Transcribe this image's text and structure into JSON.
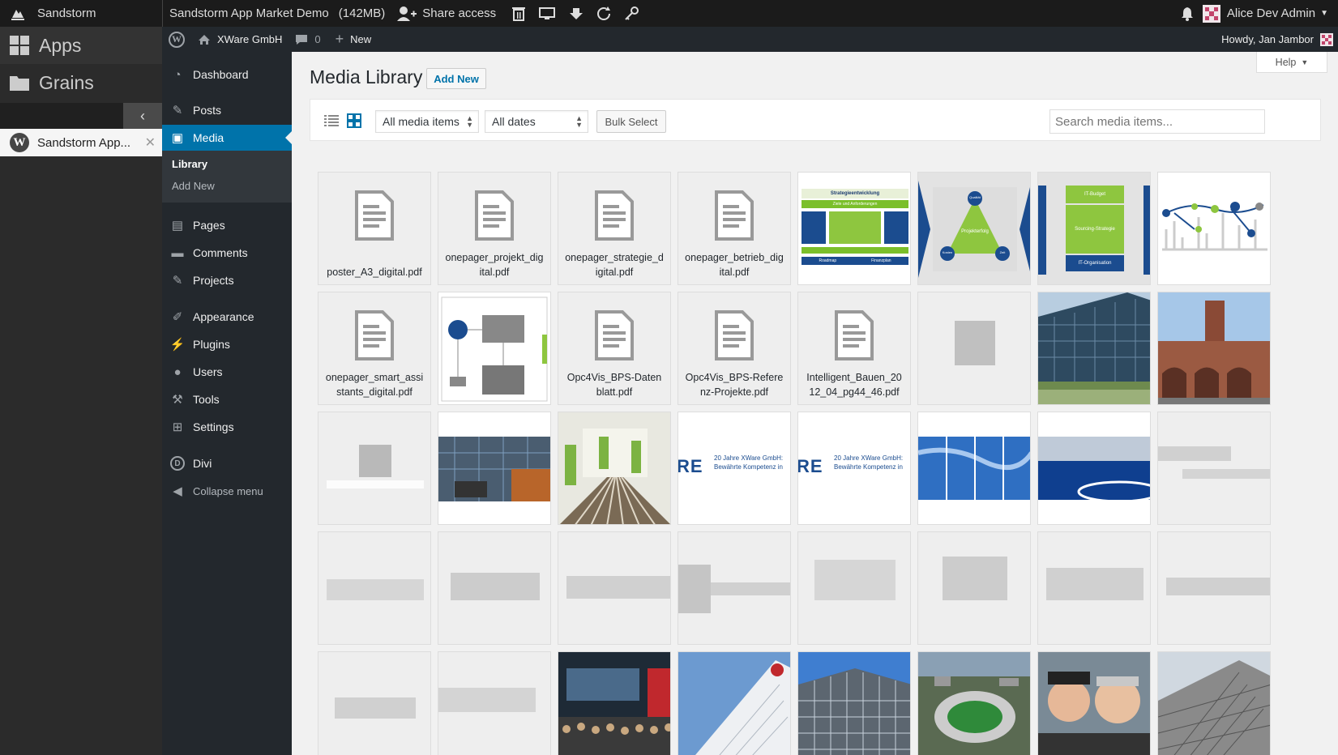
{
  "sandstorm": {
    "brand": "Sandstorm",
    "nav": [
      {
        "label": "Apps",
        "icon": "apps-grid-icon"
      },
      {
        "label": "Grains",
        "icon": "folder-icon"
      }
    ],
    "open_grain": {
      "label": "Sandstorm App...",
      "icon": "wordpress-icon"
    },
    "grain_title": "Sandstorm App Market Demo",
    "grain_size": "(142MB)",
    "share_label": "Share access",
    "user_name": "Alice Dev Admin"
  },
  "wpbar": {
    "site_name": "XWare GmbH",
    "comments_count": "0",
    "new_label": "New",
    "howdy": "Howdy, Jan Jambor"
  },
  "menu": {
    "items": [
      {
        "label": "Dashboard",
        "icon": "dashboard-icon"
      },
      {
        "label": "Posts",
        "icon": "pin-icon"
      },
      {
        "label": "Media",
        "icon": "media-icon"
      },
      {
        "label": "Pages",
        "icon": "pages-icon"
      },
      {
        "label": "Comments",
        "icon": "comment-icon"
      },
      {
        "label": "Projects",
        "icon": "pin-icon"
      },
      {
        "label": "Appearance",
        "icon": "brush-icon"
      },
      {
        "label": "Plugins",
        "icon": "plugin-icon"
      },
      {
        "label": "Users",
        "icon": "user-icon"
      },
      {
        "label": "Tools",
        "icon": "wrench-icon"
      },
      {
        "label": "Settings",
        "icon": "settings-icon"
      },
      {
        "label": "Divi",
        "icon": "divi-icon"
      },
      {
        "label": "Collapse menu",
        "icon": "collapse-icon"
      }
    ],
    "submenu": [
      "Library",
      "Add New"
    ]
  },
  "page": {
    "title": "Media Library",
    "add_new": "Add New",
    "help": "Help",
    "filter_type": "All media items",
    "filter_date": "All dates",
    "bulk_select": "Bulk Select",
    "search_placeholder": "Search media items..."
  },
  "files": [
    "poster_A3_digital.pdf",
    "onepager_projekt_digital.pdf",
    "onepager_strategie_digital.pdf",
    "onepager_betrieb_digital.pdf",
    "onepager_smart_assistants_digital.pdf",
    "Opc4Vis_BPS-Datenblatt.pdf",
    "Opc4Vis_BPS-Referenz-Projekte.pdf",
    "Intelligent_Bauen_2012_04_pg44_46.pdf"
  ],
  "thumb_texts": {
    "strategy_title": "Strategieentwicklung",
    "strategy_sub": "Ziele und Anforderungen",
    "strategy_bottom": [
      "Roadmap",
      "Finanzplan"
    ],
    "triangle_center": "Projekterfolg",
    "triangle_top": "Qualität",
    "triangle_left": "Kosten",
    "triangle_right": "Zeit",
    "budget_top": "IT-Budget",
    "budget_mid": "Sourcing-Strategie",
    "budget_bottom": "IT-Organisation",
    "anniv_logo": "RE",
    "anniv_line1": "20 Jahre XWare GmbH:",
    "anniv_line2": "Bewährte Kompetenz in"
  }
}
